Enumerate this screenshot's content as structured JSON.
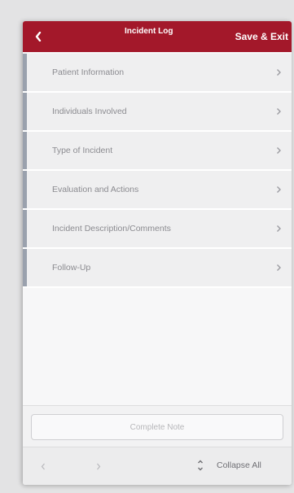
{
  "header": {
    "title": "Incident Log",
    "save_label": "Save & Exit",
    "back_icon": "chevron-left-icon"
  },
  "sections": [
    {
      "label": "Patient Information"
    },
    {
      "label": "Individuals Involved"
    },
    {
      "label": "Type of Incident"
    },
    {
      "label": "Evaluation and Actions"
    },
    {
      "label": "Incident Description/Comments"
    },
    {
      "label": "Follow-Up"
    }
  ],
  "complete": {
    "label": "Complete Note"
  },
  "footer": {
    "collapse_label": "Collapse All",
    "prev_icon": "chevron-left-icon",
    "next_icon": "chevron-right-icon",
    "collapse_icon": "collapse-icon"
  },
  "colors": {
    "header_bg": "#a3182a",
    "section_bar": "#9aa1ad",
    "section_bg": "#efeff0"
  }
}
